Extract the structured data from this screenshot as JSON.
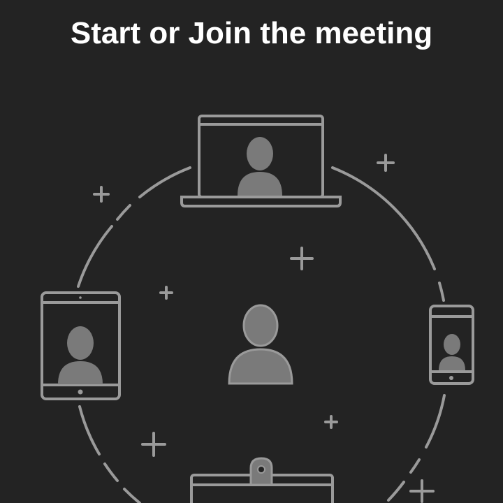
{
  "header": {
    "title": "Start or Join the meeting"
  },
  "illustration": {
    "line_color": "#9a9a9a",
    "fill_color": "#7a7a7a",
    "background": "#232323",
    "devices": [
      "laptop-icon",
      "tablet-icon",
      "phone-icon",
      "desktop-monitor-icon"
    ],
    "center": "user-avatar-icon",
    "decorations": "plus-sparkle-icon"
  }
}
